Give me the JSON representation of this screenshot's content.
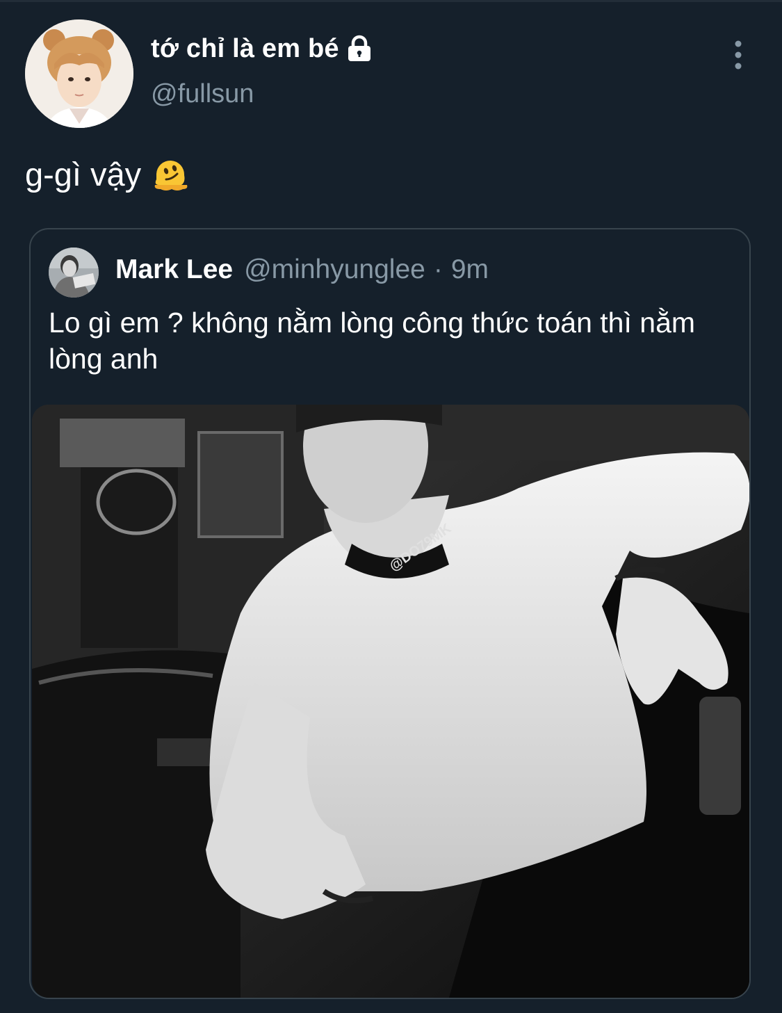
{
  "tweet": {
    "author": {
      "display_name": "tớ chỉ là em bé",
      "handle": "@fullsun",
      "protected_icon": "lock-icon",
      "avatar_icon": "profile-photo"
    },
    "text": "g-gì vậy",
    "emoji": "melting-face-emoji",
    "more_icon": "vertical-ellipsis-icon"
  },
  "quoted_tweet": {
    "display_name": "Mark Lee",
    "handle": "@minhyunglee",
    "separator": "·",
    "time": "9m",
    "text": "Lo gì em ? không nằm lòng công thức toán thì nằm lòng anh",
    "media": {
      "kind": "photo",
      "watermark": "@DO79MK"
    }
  },
  "colors": {
    "background": "#15202b",
    "text_primary": "#ffffff",
    "text_secondary": "#8899a6",
    "border": "#38444d"
  }
}
